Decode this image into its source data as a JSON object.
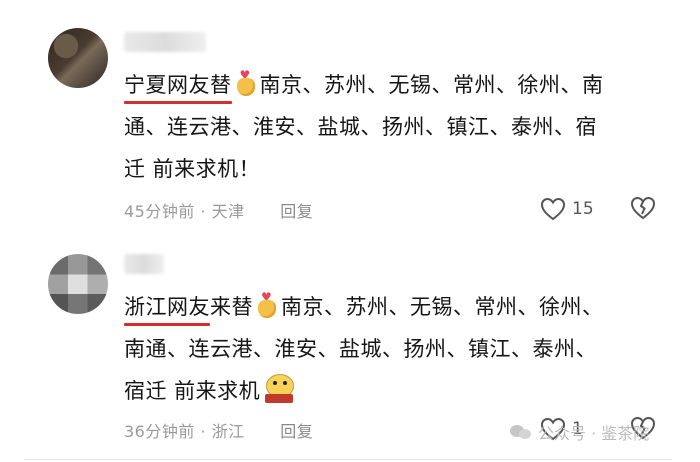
{
  "comments": [
    {
      "highlight": "宁夏网友替",
      "text_line1": "南京、苏州、无锡、常州、徐州、南",
      "text_line2": "通、连云港、淮安、盐城、扬州、镇江、泰州、宿",
      "text_line3": "迁 前来求机！",
      "time": "45分钟前",
      "location": "天津",
      "reply_label": "回复",
      "like_count": "15"
    },
    {
      "highlight": "浙江网友",
      "highlight_suffix": "来替",
      "text_line1": "南京、苏州、无锡、常州、徐州、",
      "text_line2": "南通、连云港、淮安、盐城、扬州、镇江、泰州、",
      "text_line3": "宿迁 前来求机",
      "time": "36分钟前",
      "location": "浙江",
      "reply_label": "回复",
      "like_count": "1"
    }
  ],
  "meta_separator": "·",
  "watermark": {
    "text": "公众号 · 鉴茶院"
  },
  "icons": {
    "like": "heart-outline-icon",
    "dislike": "broken-heart-icon",
    "watermark": "wechat-icon"
  }
}
